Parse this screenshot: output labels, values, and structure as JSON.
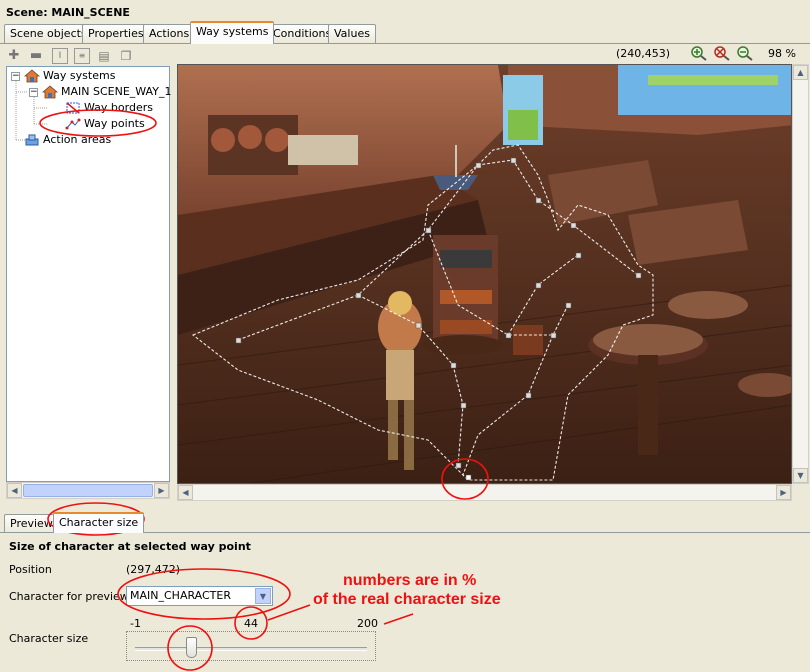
{
  "window": {
    "title": "Scene: MAIN_SCENE"
  },
  "tabs": [
    {
      "label": "Scene objects"
    },
    {
      "label": "Properties"
    },
    {
      "label": "Actions"
    },
    {
      "label": "Way systems",
      "active": true
    },
    {
      "label": "Conditions"
    },
    {
      "label": "Values"
    }
  ],
  "tree": {
    "root_label": "Way systems",
    "way_label": "MAIN SCENE_WAY_1",
    "borders_label": "Way borders",
    "points_label": "Way points",
    "action_areas_label": "Action areas"
  },
  "toolbar_icons": [
    "add-icon",
    "remove-icon",
    "rename-icon",
    "properties-icon",
    "save-icon",
    "copy-icon"
  ],
  "scene_toolbar": {
    "coords": "(240,453)",
    "zoom": "98 %",
    "icons": [
      "zoom-in-icon",
      "zoom-reset-icon",
      "zoom-out-icon"
    ]
  },
  "bottom_tabs": [
    {
      "label": "Preview"
    },
    {
      "label": "Character size",
      "active": true
    }
  ],
  "character_size_panel": {
    "heading": "Size of character at selected way point",
    "position_label": "Position",
    "position_value": "(297,472)",
    "character_label": "Character for preview",
    "character_value": "MAIN_CHARACTER",
    "size_label": "Character size",
    "slider_min": "-1",
    "slider_value": "44",
    "slider_max": "200",
    "slider_level": 44
  },
  "annotation": {
    "line1": "numbers are in %",
    "line2": "of the real character size",
    "color": "#ee1111"
  },
  "colors": {
    "accent_tab": "#e68b2c",
    "tree_border": "#7f9db9"
  }
}
